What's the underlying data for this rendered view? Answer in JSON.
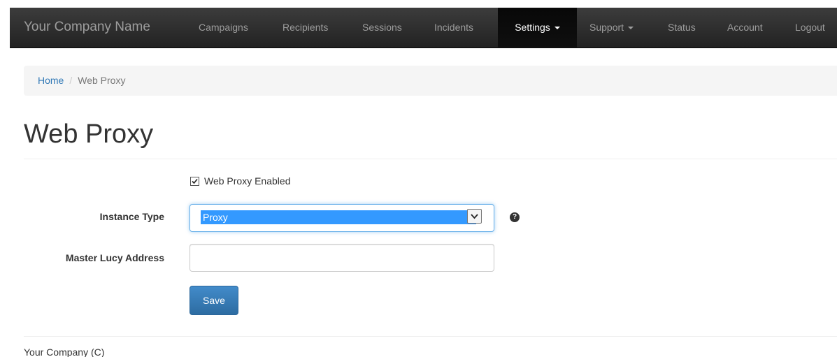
{
  "navbar": {
    "brand": "Your Company Name",
    "items": [
      {
        "label": "Campaigns"
      },
      {
        "label": "Recipients"
      },
      {
        "label": "Sessions"
      },
      {
        "label": "Incidents"
      },
      {
        "label": "Settings"
      },
      {
        "label": "Support"
      },
      {
        "label": "Status"
      },
      {
        "label": "Account"
      },
      {
        "label": "Logout"
      }
    ],
    "active": "Settings"
  },
  "breadcrumb": {
    "home": "Home",
    "separator": "/",
    "current": "Web Proxy"
  },
  "page": {
    "title": "Web Proxy"
  },
  "form": {
    "web_proxy_enabled": {
      "label": "Web Proxy Enabled",
      "checked": true
    },
    "instance_type": {
      "label": "Instance Type",
      "value": "Proxy",
      "help": "?"
    },
    "master_lucy_address": {
      "label": "Master Lucy Address",
      "value": ""
    },
    "save_label": "Save"
  },
  "footer": {
    "text": "Your Company (C)"
  },
  "colors": {
    "navbar_bg": "#222222",
    "nav_text": "#9d9d9d",
    "link": "#337ab7",
    "primary_button": "#428bca",
    "select_highlight": "#3399ff"
  }
}
